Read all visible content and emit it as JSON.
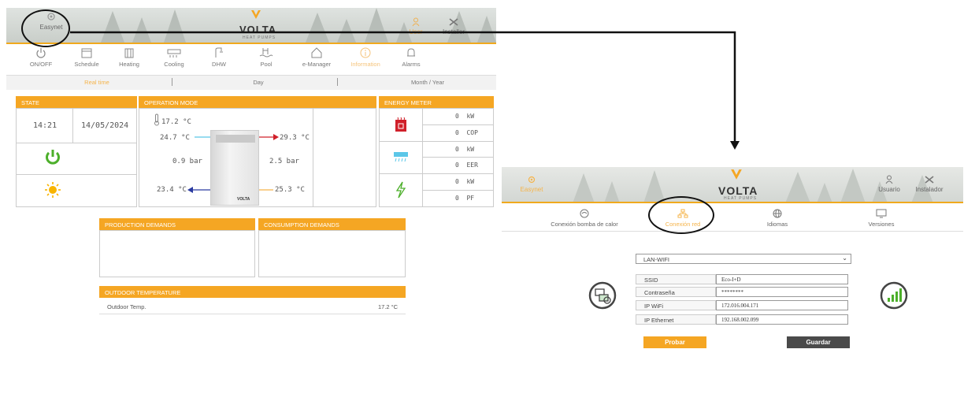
{
  "colors": {
    "accent": "#f5a623",
    "dark_button": "#4a4a4a",
    "power": "#4caf2a",
    "arrow_red": "#d0202a",
    "arrow_blue": "#2a3aa0",
    "arrow_cyan": "#5bc7e8",
    "arrow_orange": "#f5b44b"
  },
  "left": {
    "header": {
      "easynet_label": "Easynet",
      "easynet_icon": "gear-icon",
      "logo": "VOLTA",
      "logo_sub": "HEAT PUMPS",
      "user_label": "User",
      "installer_label": "Installer"
    },
    "menu": [
      {
        "label": "ON/OFF",
        "icon": "power-icon"
      },
      {
        "label": "Schedule",
        "icon": "calendar-icon"
      },
      {
        "label": "Heating",
        "icon": "radiator-icon"
      },
      {
        "label": "Cooling",
        "icon": "ac-icon"
      },
      {
        "label": "DHW",
        "icon": "shower-icon"
      },
      {
        "label": "Pool",
        "icon": "pool-icon"
      },
      {
        "label": "e-Manager",
        "icon": "home-icon"
      },
      {
        "label": "Information",
        "icon": "info-icon"
      },
      {
        "label": "Alarms",
        "icon": "bell-icon"
      }
    ],
    "subtabs": [
      "Real time",
      "Day",
      "Month / Year"
    ],
    "state": {
      "title": "STATE",
      "time": "14:21",
      "date": "14/05/2024",
      "power_icon": "power-icon",
      "weather_icon": "sun-icon"
    },
    "operation": {
      "title": "OPERATION MODE",
      "room_temp": "17.2 °C",
      "in_left_top": "24.7 °C",
      "out_right_top": "29.3 °C",
      "pressure_left": "0.9 bar",
      "pressure_right": "2.5 bar",
      "in_left_bottom": "23.4 °C",
      "out_right_bottom": "25.3 °C",
      "unit_brand": "VOLTA"
    },
    "energy": {
      "title": "ENERGY METER",
      "rows": [
        {
          "value": "0",
          "unit": "kW"
        },
        {
          "value": "0",
          "unit": "COP"
        },
        {
          "value": "0",
          "unit": "kW"
        },
        {
          "value": "0",
          "unit": "EER"
        },
        {
          "value": "0",
          "unit": "kW"
        },
        {
          "value": "0",
          "unit": "PF"
        }
      ]
    },
    "production_title": "PRODUCTION DEMANDS",
    "consumption_title": "CONSUMPTION DEMANDS",
    "outdoor": {
      "title": "OUTDOOR TEMPERATURE",
      "label": "Outdoor Temp.",
      "value": "17.2 °C"
    }
  },
  "right": {
    "header": {
      "easynet_label": "Easynet",
      "logo": "VOLTA",
      "logo_sub": "HEAT PUMPS",
      "user_label": "Usuario",
      "installer_label": "Instalador"
    },
    "menu": [
      {
        "label": "Conexión bomba de calor",
        "icon": "heatpump-icon"
      },
      {
        "label": "Conexión red",
        "icon": "network-icon"
      },
      {
        "label": "Idiomas",
        "icon": "globe-icon"
      },
      {
        "label": "Versiones",
        "icon": "monitor-icon"
      }
    ],
    "connection_select": "LAN-WIFI",
    "form": [
      {
        "label": "SSID",
        "value": "Eco-I+D"
      },
      {
        "label": "Contraseña",
        "value": "********"
      },
      {
        "label": "IP WiFi",
        "value": "172.016.004.171"
      },
      {
        "label": "IP Ethernet",
        "value": "192.168.002.099"
      }
    ],
    "test_button": "Probar",
    "save_button": "Guardar"
  }
}
